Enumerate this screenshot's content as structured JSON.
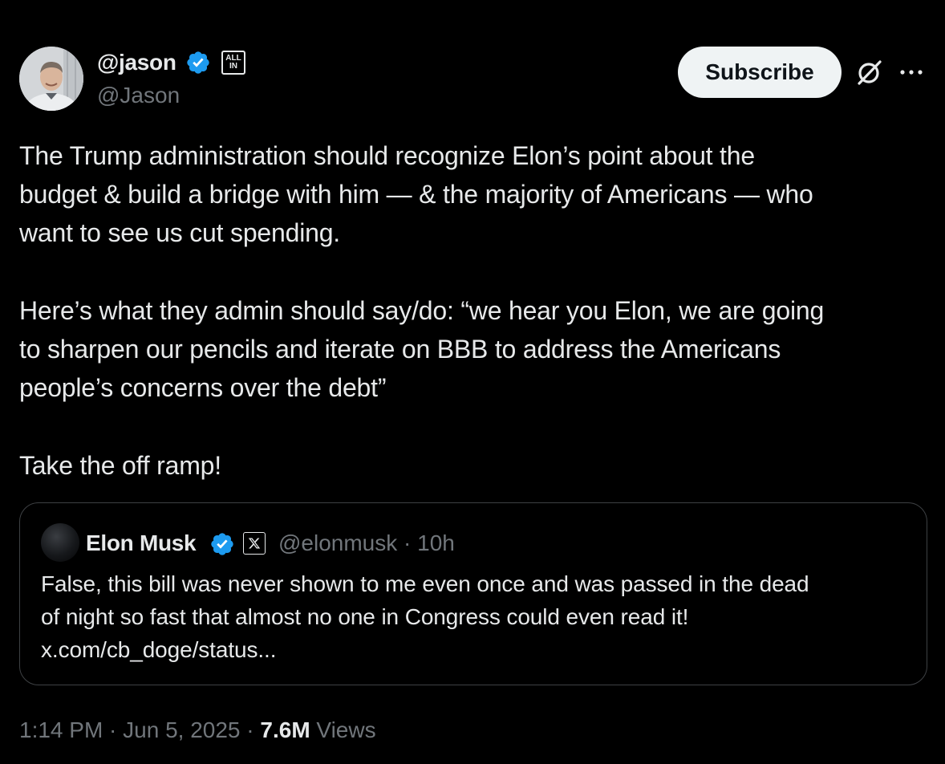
{
  "author": {
    "display_name": "@jason",
    "handle": "@Jason",
    "affiliate_badge_line1": "ALL",
    "affiliate_badge_line2": "IN"
  },
  "actions": {
    "subscribe_label": "Subscribe"
  },
  "icons": {
    "verified": "verified-badge-icon",
    "grok": "grok-icon",
    "more": "more-options-icon",
    "x_logo": "x-logo-icon"
  },
  "tweet": {
    "text": "The Trump administration should recognize Elon’s point about the\nbudget & build a bridge with him — & the majority of Americans — who\nwant to see us cut spending.\n\nHere’s what they admin should say/do: “we hear you Elon, we are going\nto sharpen our pencils and iterate on BBB to address the Americans\npeople’s concerns over the debt”\n\nTake the off ramp!"
  },
  "quoted": {
    "display_name": "Elon Musk",
    "meta": "@elonmusk · 10h",
    "text": "False, this bill was never shown to me even once and was passed in the dead\nof night so fast that almost no one in Congress could even read it!\nx.com/cb_doge/status..."
  },
  "footer": {
    "timestamp": "1:14 PM · Jun 5, 2025 · ",
    "views_count": "7.6M",
    "views_label": " Views"
  },
  "colors": {
    "background": "#000000",
    "text": "#e7e9ea",
    "secondary_text": "#71767b",
    "verified_blue": "#1d9bf0",
    "border": "#3e4144"
  }
}
